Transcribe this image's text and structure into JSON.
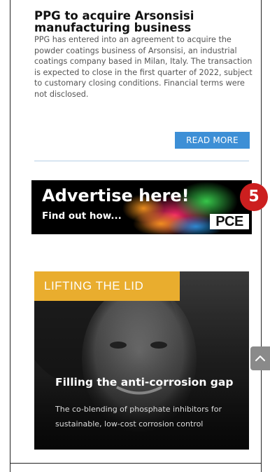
{
  "article": {
    "title": "PPG to acquire Arsonsisi manufacturing business",
    "body": "PPG has entered into an agreement to acquire the powder coatings business of Arsonsisi, an industrial coatings company based in Milan, Italy. The transaction is expected to close in the first quarter of 2022, subject to customary closing conditions. Financial terms were not disclosed.",
    "read_more_label": "READ MORE"
  },
  "advert": {
    "headline": "Advertise here!",
    "subline": "Find out how...",
    "logo_text": "PCE"
  },
  "badge": {
    "number": "5",
    "color": "#cc1f1f"
  },
  "feature": {
    "tag": "LIFTING THE LID",
    "title": "Filling the anti-corrosion gap",
    "description": "The co-blending of phosphate inhibitors for sustainable, low-cost corrosion control"
  },
  "scroll_top": {
    "icon": "chevron-up-icon"
  },
  "colors": {
    "accent": "#3d8fd6",
    "tag": "#e9ad2e"
  }
}
